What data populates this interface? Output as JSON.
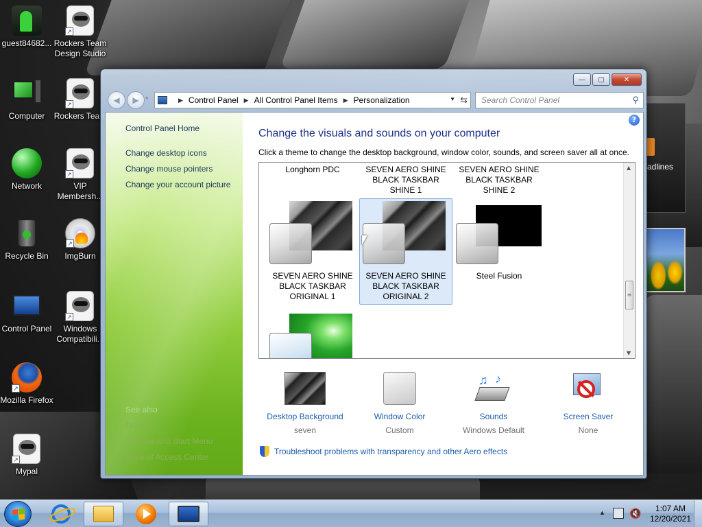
{
  "desktop": {
    "icons_left": [
      {
        "label": "guest84682..."
      },
      {
        "label": "Computer"
      },
      {
        "label": "Network"
      },
      {
        "label": "Recycle Bin"
      },
      {
        "label": "Control Panel"
      },
      {
        "label": "Mozilla Firefox"
      },
      {
        "label": "Mypal"
      }
    ],
    "icons_right": [
      {
        "label": "Rockers Team Design Studio"
      },
      {
        "label": "Rockers Team"
      },
      {
        "label": "VIP Membersh..."
      },
      {
        "label": "ImgBurn"
      },
      {
        "label": "Windows Compatibili..."
      }
    ],
    "widget_label": "adlines"
  },
  "window": {
    "controls": {
      "minimize": "—",
      "maximize": "▢",
      "close": "✕"
    },
    "nav": {
      "back": "◀",
      "forward": "▶",
      "dropdown": "▾"
    },
    "breadcrumb": [
      "Control Panel",
      "All Control Panel Items",
      "Personalization"
    ],
    "breadcrumb_sep": "▶",
    "search_placeholder": "Search Control Panel",
    "left_pane": {
      "home": "Control Panel Home",
      "links": [
        "Change desktop icons",
        "Change mouse pointers",
        "Change your account picture"
      ],
      "see_also_title": "See also",
      "see_also": [
        "Display",
        "Taskbar and Start Menu",
        "Ease of Access Center"
      ]
    },
    "heading": "Change the visuals and sounds on your computer",
    "subheading": "Click a theme to change the desktop background, window color, sounds, and screen saver all at once.",
    "themes_row1": [
      "Longhorn PDC",
      "SEVEN AERO SHINE BLACK TASKBAR SHINE 1",
      "SEVEN AERO SHINE BLACK TASKBAR SHINE 2"
    ],
    "themes_row2": [
      "SEVEN AERO SHINE BLACK TASKBAR ORIGINAL 1",
      "SEVEN AERO SHINE BLACK TASKBAR ORIGINAL 2",
      "Steel Fusion"
    ],
    "selected_theme": "SEVEN AERO SHINE BLACK TASKBAR ORIGINAL 2",
    "bottom": [
      {
        "label": "Desktop Background",
        "value": "seven"
      },
      {
        "label": "Window Color",
        "value": "Custom"
      },
      {
        "label": "Sounds",
        "value": "Windows Default"
      },
      {
        "label": "Screen Saver",
        "value": "None"
      }
    ],
    "troubleshoot": "Troubleshoot problems with transparency and other Aero effects"
  },
  "taskbar": {
    "items": [
      "start-button",
      "internet-explorer",
      "windows-explorer",
      "windows-media-player",
      "control-panel"
    ],
    "clock_time": "1:07 AM",
    "clock_date": "12/20/2021"
  },
  "colors": {
    "link": "#1e5ea8",
    "heading": "#1e3287",
    "left_pane_green": "#8fcc3c",
    "selection": "#dbe9f9"
  }
}
